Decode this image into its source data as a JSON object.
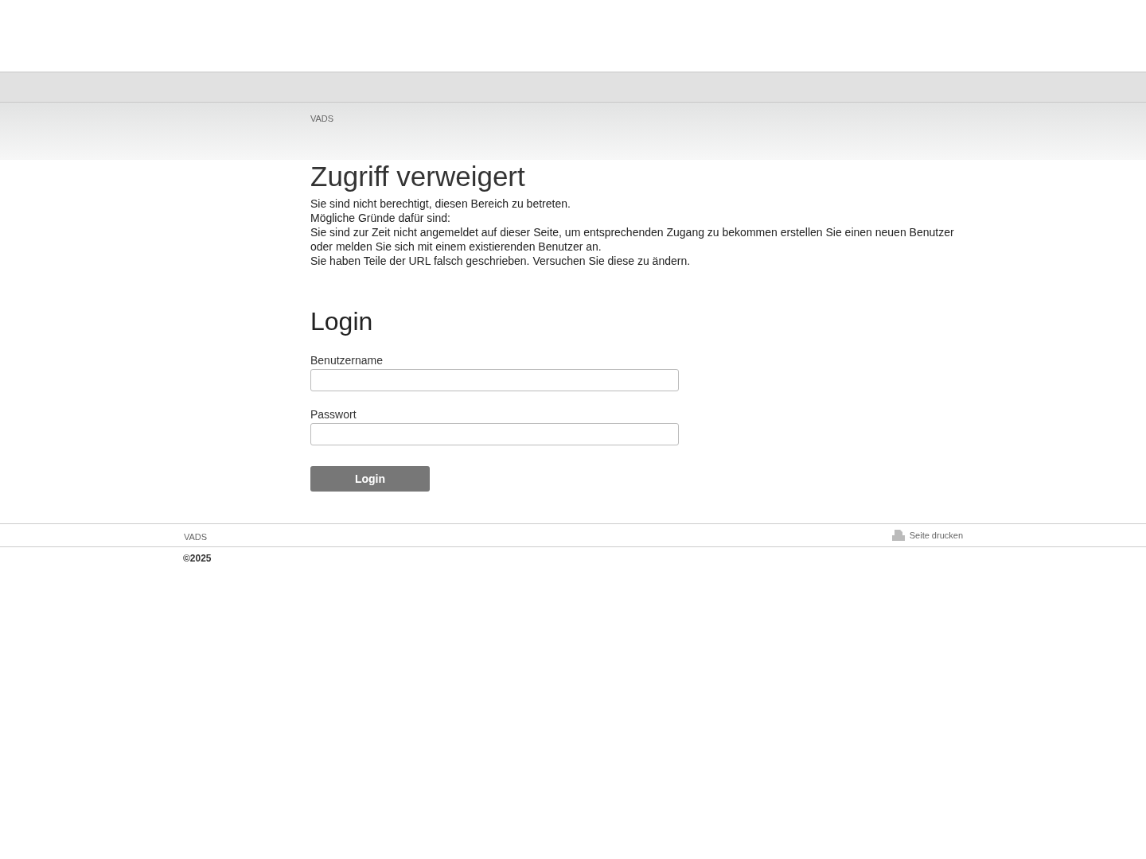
{
  "breadcrumb": "VADS",
  "title": "Zugriff verweigert",
  "paragraphs": [
    "Sie sind nicht berechtigt, diesen Bereich zu betreten.",
    "Mögliche Gründe dafür sind:",
    "Sie sind zur Zeit nicht angemeldet auf dieser Seite, um entsprechenden Zugang zu bekommen erstellen Sie einen neuen Benutzer oder melden Sie sich mit einem existierenden Benutzer an.",
    "Sie haben Teile der URL falsch geschrieben. Versuchen Sie diese zu ändern."
  ],
  "login": {
    "title": "Login",
    "fields": [
      {
        "label": "Benutzername"
      },
      {
        "label": "Passwort"
      }
    ],
    "button": "Login"
  },
  "footer": {
    "link": "VADS",
    "print": "Seite drucken",
    "copyright": "©2025"
  }
}
